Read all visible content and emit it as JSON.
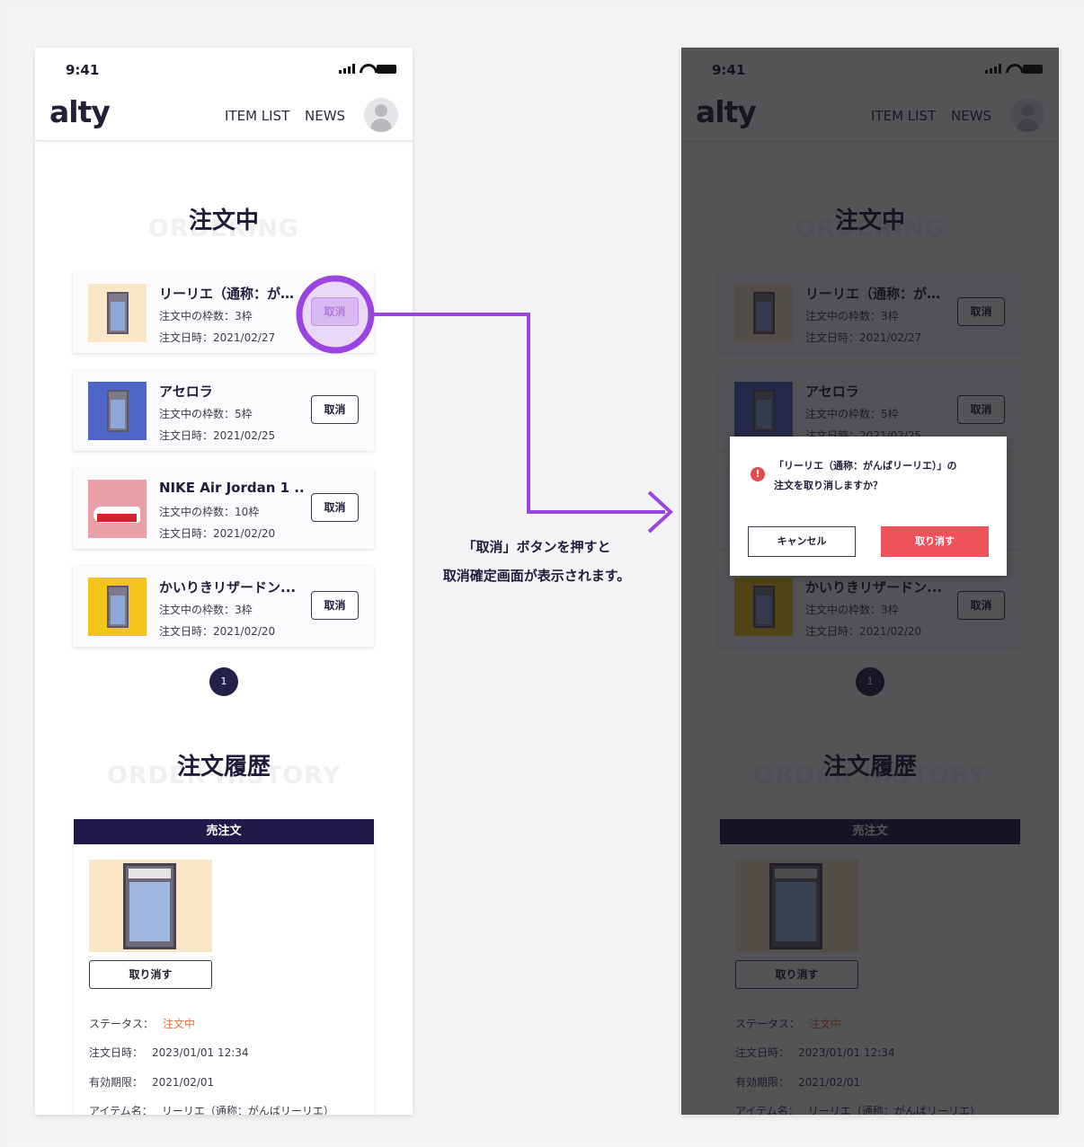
{
  "status_bar": {
    "time": "9:41"
  },
  "header": {
    "logo": "alty",
    "nav": [
      "ITEM LIST",
      "NEWS"
    ]
  },
  "ordering": {
    "title": "注文中",
    "subtitle": "ORDERING",
    "items": [
      {
        "name": "リーリエ（通称：が…",
        "slots": "注文中の枠数：3枠",
        "date": "注文日時：2021/02/27",
        "button": "取消",
        "thumb_bg": "#f9e7c7"
      },
      {
        "name": "アセロラ",
        "slots": "注文中の枠数：5枠",
        "date": "注文日時：2021/02/25",
        "button": "取消",
        "thumb_bg": "#4f66c8"
      },
      {
        "name": "NIKE Air Jordan 1 ...",
        "slots": "注文中の枠数：10枠",
        "date": "注文日時：2021/02/20",
        "button": "取消",
        "thumb_bg": "#e9a0a8"
      },
      {
        "name": "かいりきリザードン...",
        "slots": "注文中の枠数：3枠",
        "date": "注文日時：2021/02/20",
        "button": "取消",
        "thumb_bg": "#f3c51a"
      }
    ],
    "page": "1"
  },
  "history": {
    "title": "注文履歴",
    "subtitle": "ORDER HISTORY",
    "card_header": "売注文",
    "cancel_button": "取り消す",
    "rows": [
      {
        "label": "ステータス：",
        "value": "注文中"
      },
      {
        "label": "注文日時：",
        "value": "2023/01/01 12:34"
      },
      {
        "label": "有効期限：",
        "value": "2021/02/01"
      },
      {
        "label": "アイテム名：",
        "value": "リーリエ（通称：がんばリーリエ）"
      }
    ]
  },
  "annotation": {
    "line1": "「取消」ボタンを押すと",
    "line2": "取消確定画面が表示されます。",
    "color": "#9b45e0"
  },
  "dialog": {
    "message_line1": "「リーリエ（通称：がんばリーリエ）」の",
    "message_line2": "注文を取り消しますか？",
    "cancel": "キャンセル",
    "confirm": "取り消す",
    "alert_icon": "!"
  }
}
